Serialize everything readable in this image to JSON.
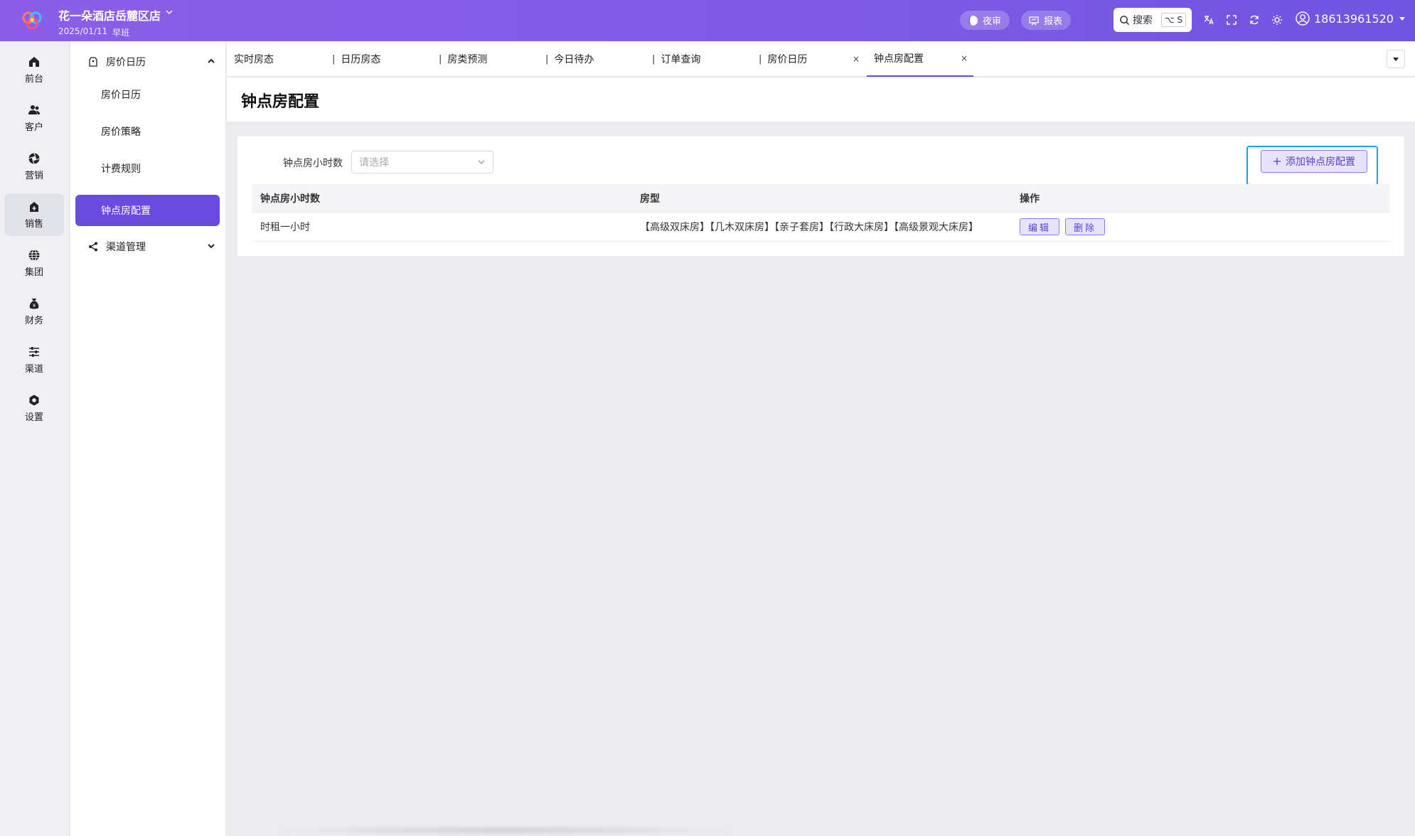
{
  "header": {
    "hotel_name": "花一朵酒店岳麓区店",
    "date": "2025/01/11",
    "shift": "早班",
    "night_audit_label": "夜审",
    "report_label": "报表",
    "search_label": "搜索",
    "search_shortcut": "⌥ S",
    "username": "18613961520"
  },
  "rail": {
    "items": [
      {
        "label": "前台",
        "icon": "home-icon"
      },
      {
        "label": "客户",
        "icon": "users-icon"
      },
      {
        "label": "营销",
        "icon": "aperture-icon"
      },
      {
        "label": "销售",
        "icon": "store-icon"
      },
      {
        "label": "集团",
        "icon": "globe-icon"
      },
      {
        "label": "财务",
        "icon": "money-bag-icon"
      },
      {
        "label": "渠道",
        "icon": "sliders-icon"
      },
      {
        "label": "设置",
        "icon": "gear-icon"
      }
    ]
  },
  "subnav": {
    "group1": "房价日历",
    "items": [
      "房价日历",
      "房价策略",
      "计费规则",
      "钟点房配置"
    ],
    "group2": "渠道管理"
  },
  "tabs": [
    "实时房态",
    "日历房态",
    "房类预测",
    "今日待办",
    "订单查询",
    "房价日历",
    "钟点房配置"
  ],
  "page": {
    "title": "钟点房配置",
    "filter_label": "钟点房小时数",
    "filter_placeholder": "请选择",
    "add_button": "添加钟点房配置"
  },
  "table": {
    "columns": [
      "钟点房小时数",
      "房型",
      "操作"
    ],
    "rows": [
      {
        "hours": "时租一小时",
        "room_types": "【高级双床房】【几木双床房】【亲子套房】【行政大床房】【高级景观大床房】",
        "edit": "编辑",
        "delete": "删除"
      }
    ]
  },
  "colors": {
    "accent": "#6a4be0",
    "topbar_start": "#8a5ee8",
    "topbar_end": "#6f55e0",
    "highlight_border": "#1ba3e6"
  }
}
